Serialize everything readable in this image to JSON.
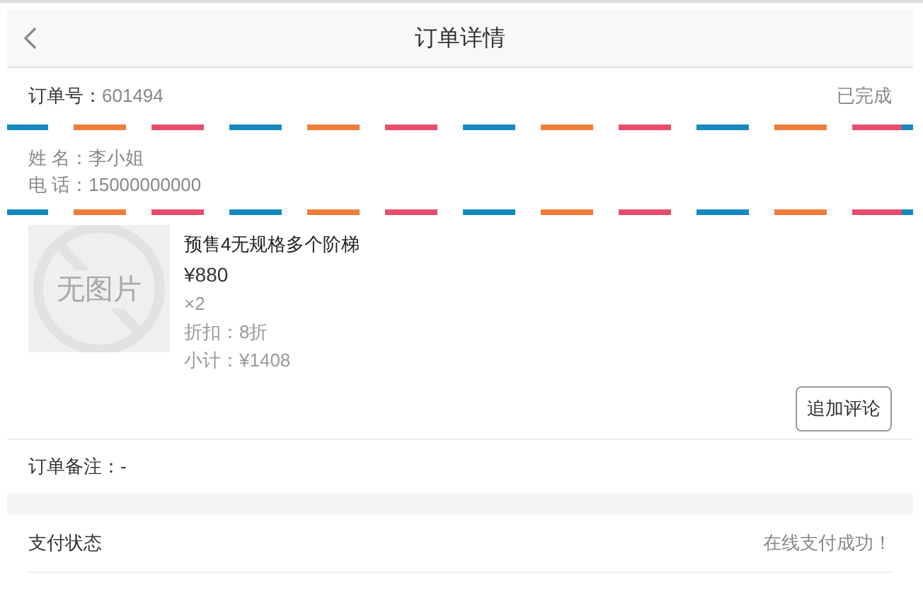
{
  "header": {
    "title": "订单详情"
  },
  "order": {
    "label": "订单号：",
    "number": "601494",
    "status": "已完成"
  },
  "contact": [
    "姓 名：李小姐",
    "电 话：15000000000"
  ],
  "products": [
    {
      "name": "预售4无规格多个阶梯",
      "price": "¥880",
      "quantity": "×2",
      "discount": "折扣：8折",
      "subtotal": "小计：¥1408",
      "image_text": "无图片"
    }
  ],
  "action_button": "追加评论",
  "remark": "订单备注：-",
  "payment": {
    "label": "支付状态",
    "value": "在线支付成功！"
  }
}
